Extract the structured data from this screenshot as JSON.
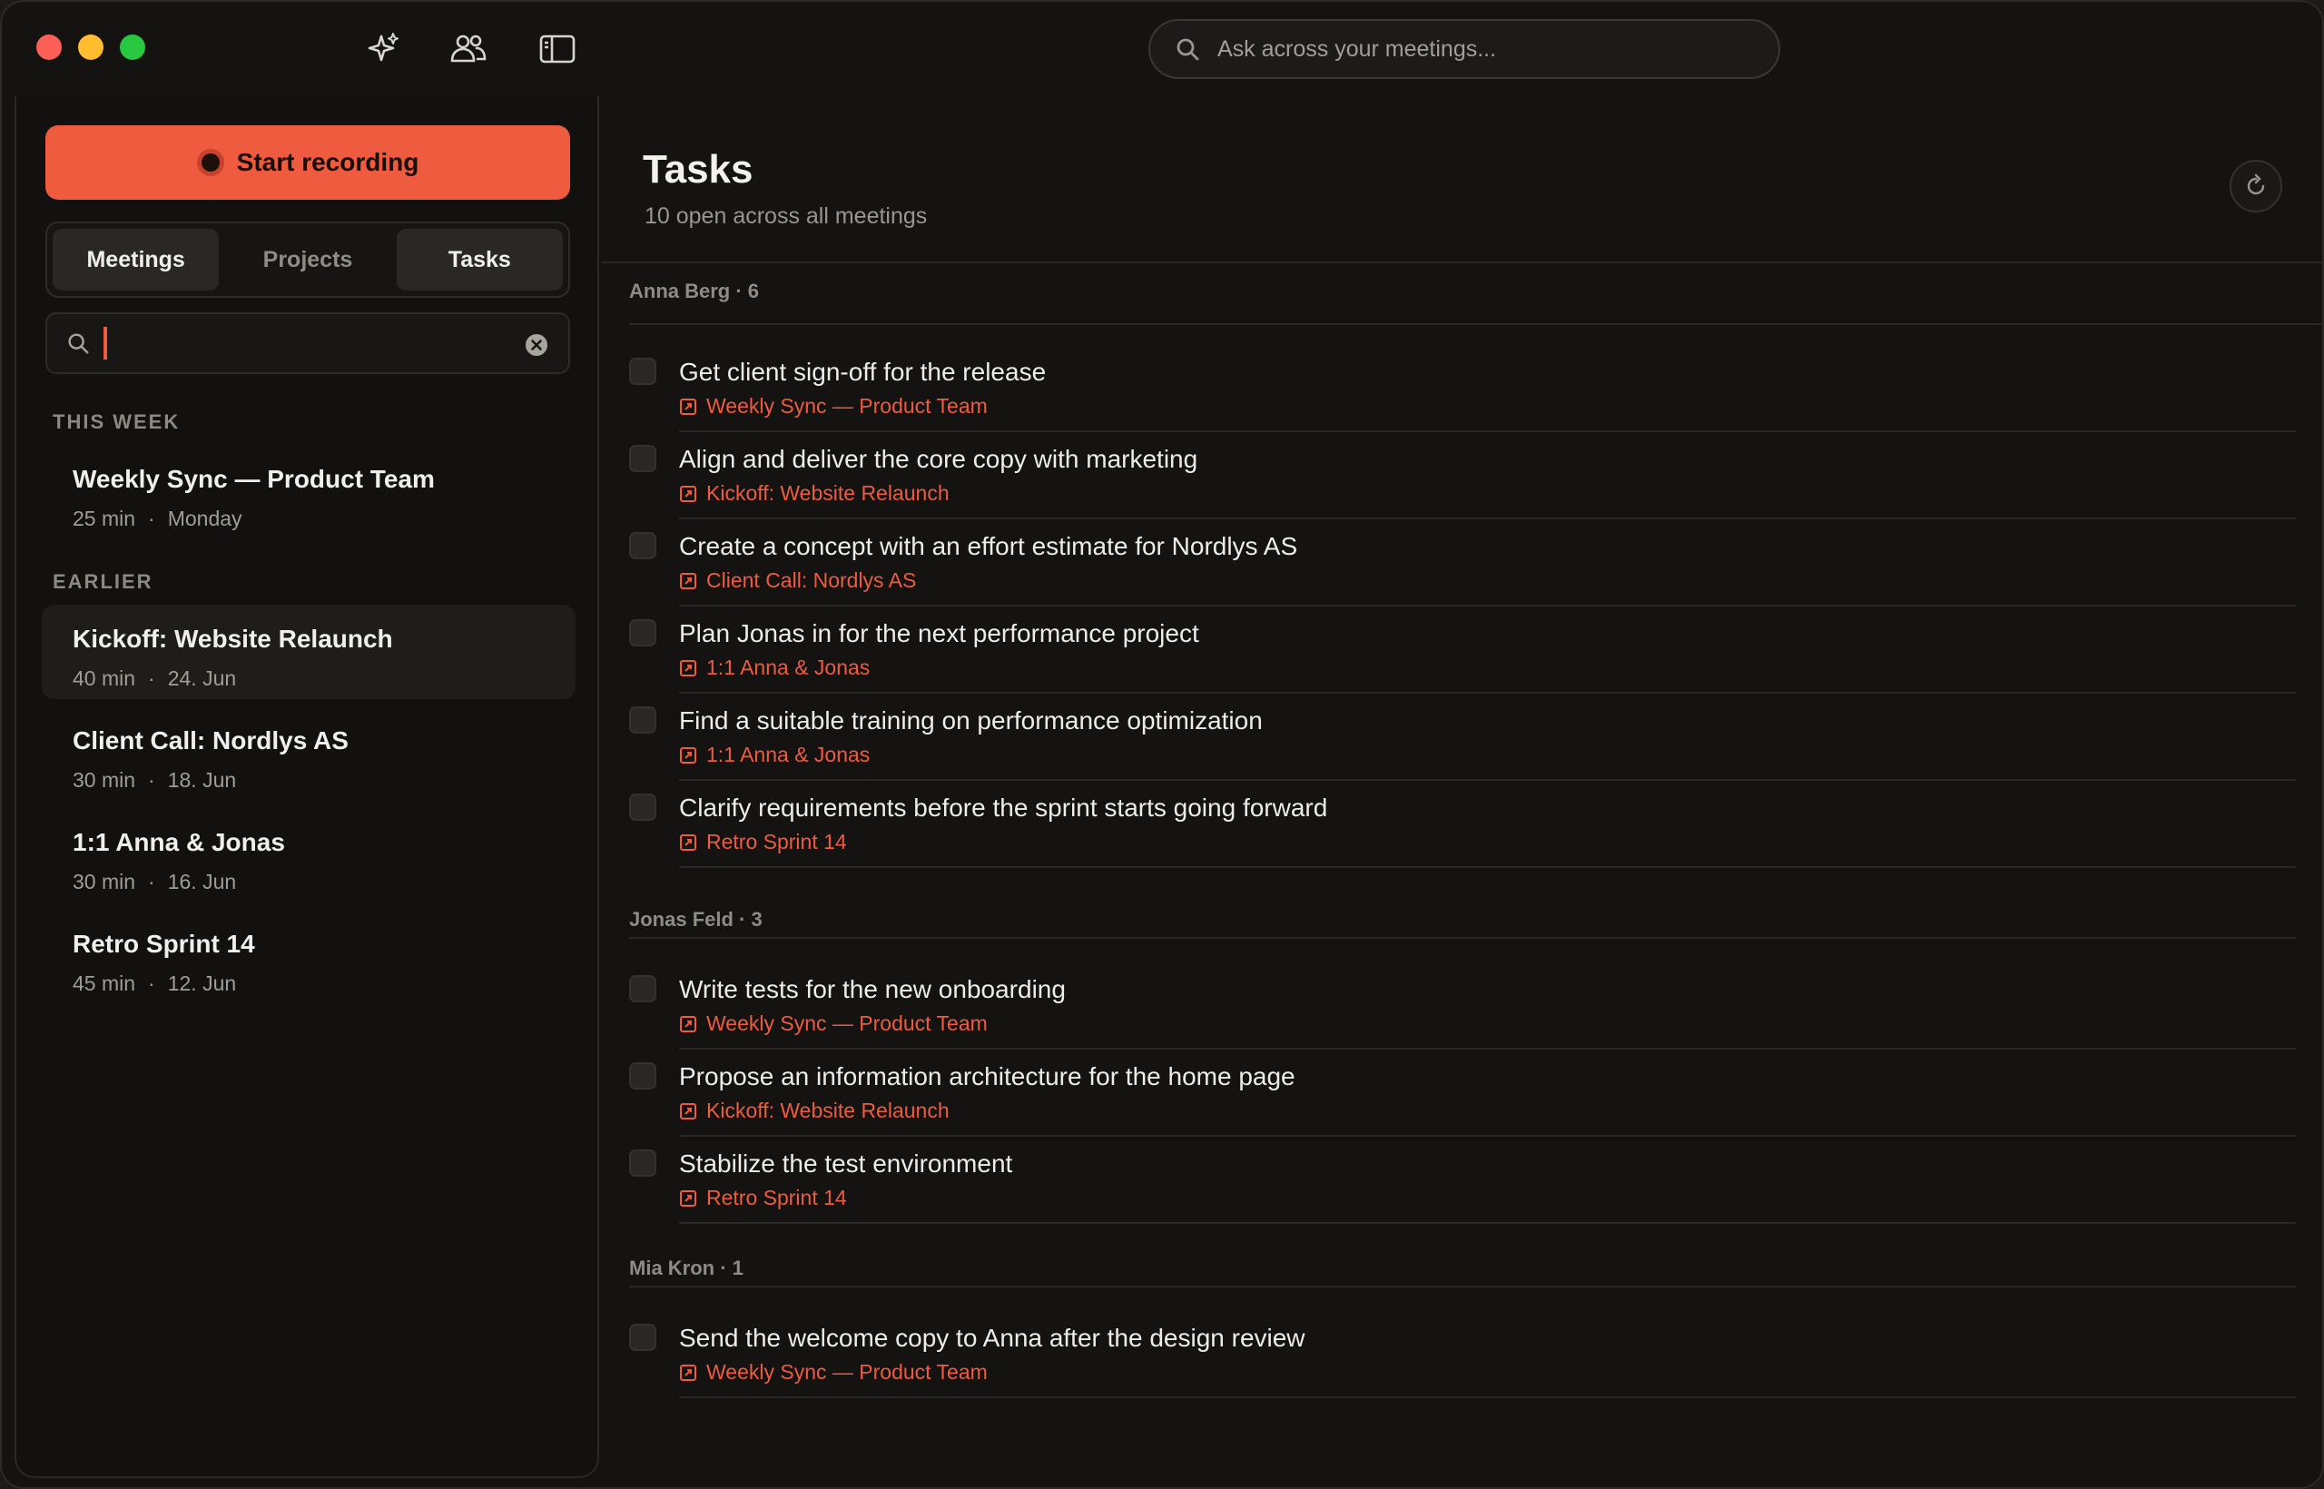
{
  "titlebar": {
    "icons": [
      "sparkles-icon",
      "people-icon",
      "sidebar-toggle-icon"
    ],
    "search_placeholder": "Ask across your meetings..."
  },
  "sidebar": {
    "record_label": "Start recording",
    "tabs": [
      {
        "label": "Meetings",
        "active": true
      },
      {
        "label": "Projects",
        "active": false
      },
      {
        "label": "Tasks",
        "active": true
      }
    ],
    "search_value": "",
    "sections": [
      {
        "label": "THIS WEEK",
        "meetings": [
          {
            "title": "Weekly Sync — Product Team",
            "duration": "25 min",
            "date": "Monday"
          }
        ]
      },
      {
        "label": "EARLIER",
        "meetings": [
          {
            "title": "Kickoff: Website Relaunch",
            "duration": "40 min",
            "date": "24. Jun",
            "selected": true
          },
          {
            "title": "Client Call: Nordlys AS",
            "duration": "30 min",
            "date": "18. Jun"
          },
          {
            "title": "1:1 Anna & Jonas",
            "duration": "30 min",
            "date": "16. Jun"
          },
          {
            "title": "Retro Sprint 14",
            "duration": "45 min",
            "date": "12. Jun"
          }
        ]
      }
    ]
  },
  "main": {
    "title": "Tasks",
    "subtitle": "10 open across all meetings",
    "groups": [
      {
        "label": "Anna Berg · 6",
        "tasks": [
          {
            "title": "Get client sign-off for the release",
            "source": "Weekly Sync — Product Team"
          },
          {
            "title": "Align and deliver the core copy with marketing",
            "source": "Kickoff: Website Relaunch"
          },
          {
            "title": "Create a concept with an effort estimate for Nordlys AS",
            "source": "Client Call: Nordlys AS"
          },
          {
            "title": "Plan Jonas in for the next performance project",
            "source": "1:1 Anna & Jonas"
          },
          {
            "title": "Find a suitable training on performance optimization",
            "source": "1:1 Anna & Jonas"
          },
          {
            "title": "Clarify requirements before the sprint starts going forward",
            "source": "Retro Sprint 14"
          }
        ]
      },
      {
        "label": "Jonas Feld · 3",
        "tasks": [
          {
            "title": "Write tests for the new onboarding",
            "source": "Weekly Sync — Product Team"
          },
          {
            "title": "Propose an information architecture for the home page",
            "source": "Kickoff: Website Relaunch"
          },
          {
            "title": "Stabilize the test environment",
            "source": "Retro Sprint 14"
          }
        ]
      },
      {
        "label": "Mia Kron · 1",
        "tasks": [
          {
            "title": "Send the welcome copy to Anna after the design review",
            "source": "Weekly Sync — Product Team"
          }
        ]
      }
    ]
  },
  "colors": {
    "accent": "#ee5b3f",
    "background": "#141311"
  }
}
